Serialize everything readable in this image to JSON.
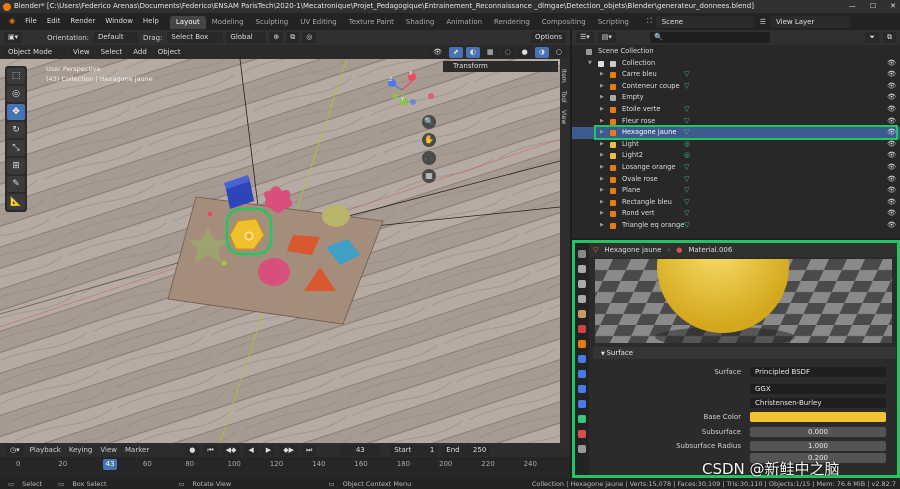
{
  "window": {
    "title": "Blender* [C:\\Users\\Federico Arenas\\Documents\\Federico\\ENSAM ParisTech\\2020-1\\Mecatronique\\Projet_Pedagogique\\Entrainement_Reconnaissance _dlmgae\\Detection_objets\\Blender\\generateur_donnees.blend]",
    "min": "—",
    "max": "☐",
    "close": "✕"
  },
  "menu": {
    "items": [
      "File",
      "Edit",
      "Render",
      "Window",
      "Help"
    ],
    "workspaces": [
      "Layout",
      "Modeling",
      "Sculpting",
      "UV Editing",
      "Texture Paint",
      "Shading",
      "Animation",
      "Rendering",
      "Compositing",
      "Scripting"
    ],
    "active_workspace": "Layout",
    "scene_label": "Scene",
    "view_layer_label": "View Layer"
  },
  "viewport_header": {
    "mode": "Object Mode",
    "view": "View",
    "select": "Select",
    "add": "Add",
    "object": "Object",
    "orientation_label": "Orientation:",
    "orientation_value": "Default",
    "drag_label": "Drag:",
    "drag_value": "Select Box",
    "transform_value": "Global",
    "options": "Options"
  },
  "viewport": {
    "perspective_label": "User Perspective",
    "collection_label": "(43) Collection | Hexagone jaune",
    "transform_panel": "Transform",
    "npanel_tabs": [
      "Item",
      "Tool",
      "View"
    ],
    "gizmo_labels": {
      "x": "X",
      "y": "Y",
      "z": "Z"
    }
  },
  "timeline": {
    "playback": "Playback",
    "keying": "Keying",
    "view": "View",
    "marker": "Marker",
    "current_frame": "43",
    "start_label": "Start",
    "start_value": "1",
    "end_label": "End",
    "end_value": "250",
    "ruler": [
      0,
      20,
      40,
      60,
      80,
      100,
      120,
      140,
      160,
      180,
      200,
      220,
      240
    ]
  },
  "outliner": {
    "search_placeholder": "",
    "scene_collection": "Scene Collection",
    "collection": "Collection",
    "items": [
      {
        "name": "Carre bleu",
        "type": "mesh",
        "selected": false
      },
      {
        "name": "Conteneur coupe",
        "type": "mesh",
        "selected": false
      },
      {
        "name": "Empty",
        "type": "empty",
        "selected": false
      },
      {
        "name": "Etoile verte",
        "type": "mesh",
        "selected": false
      },
      {
        "name": "Fleur rose",
        "type": "mesh",
        "selected": false
      },
      {
        "name": "Hexagone jaune",
        "type": "mesh",
        "selected": true
      },
      {
        "name": "Light",
        "type": "light",
        "selected": false
      },
      {
        "name": "Light2",
        "type": "light",
        "selected": false
      },
      {
        "name": "Losange orange",
        "type": "mesh",
        "selected": false
      },
      {
        "name": "Ovale rose",
        "type": "mesh",
        "selected": false
      },
      {
        "name": "Plane",
        "type": "mesh",
        "selected": false
      },
      {
        "name": "Rectangle bleu",
        "type": "mesh",
        "selected": false
      },
      {
        "name": "Rond vert",
        "type": "mesh",
        "selected": false
      },
      {
        "name": "Triangle eq orange",
        "type": "mesh",
        "selected": false
      }
    ]
  },
  "properties": {
    "object_name": "Hexagone jaune",
    "material_name": "Material.006",
    "section": "Surface",
    "rows": [
      {
        "label": "Surface",
        "value": "Principled BSDF",
        "kind": "field"
      },
      {
        "label": "",
        "value": "GGX",
        "kind": "field"
      },
      {
        "label": "",
        "value": "Christensen-Burley",
        "kind": "field"
      },
      {
        "label": "Base Color",
        "value": "",
        "kind": "color"
      },
      {
        "label": "Subsurface",
        "value": "0.000",
        "kind": "num"
      },
      {
        "label": "Subsurface Radius",
        "value": "1.000",
        "kind": "num"
      },
      {
        "label": "",
        "value": "0.200",
        "kind": "num"
      }
    ],
    "base_color": "#f4c132"
  },
  "statusbar": {
    "select": "Select",
    "box_select": "Box Select",
    "rotate_view": "Rotate View",
    "context_menu": "Object Context Menu",
    "stats": "Collection | Hexagone jaune | Verts:15,078 | Faces:30,109 | Tris:30,110 | Objects:1/15 | Mem: 76.6 MiB | v2.82.7"
  },
  "watermark": "CSDN @新鲑中之脑",
  "colors": {
    "accent": "#4772b3",
    "highlight_box": "#22c55e",
    "selected_row": "#3d5b8f"
  }
}
